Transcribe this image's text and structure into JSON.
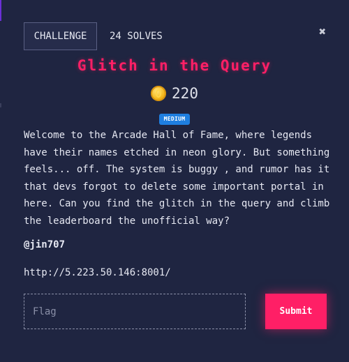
{
  "colors": {
    "background": "#1f2541",
    "accent": "#ff1f66",
    "badge": "#1f7fe0",
    "text": "#e6e8f2"
  },
  "tabs": {
    "challenge_label": "CHALLENGE",
    "solves_label": "24 SOLVES"
  },
  "close": {
    "icon": "close-icon",
    "glyph": "✖"
  },
  "challenge": {
    "title": "Glitch in the Query",
    "points_icon": "coin-icon",
    "points": "220",
    "difficulty": "MEDIUM",
    "description": "Welcome to the Arcade Hall of Fame, where legends have their names etched in neon glory. But something feels... off. The system is buggy , and rumor has it that devs forgot to delete some important portal in here. Can you find the glitch in the query and climb the leaderboard the unofficial way?",
    "author": "@jin707",
    "link": "http://5.223.50.146:8001/"
  },
  "form": {
    "flag_placeholder": "Flag",
    "flag_value": "",
    "submit_label": "Submit"
  }
}
